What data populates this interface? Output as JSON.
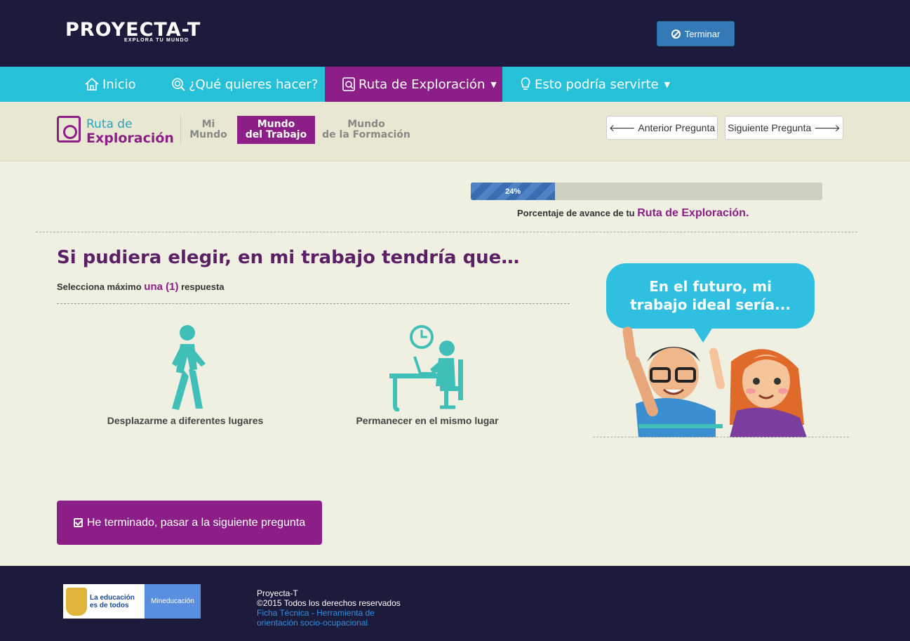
{
  "header": {
    "logo_text": "PROYECTA-T",
    "logo_subtitle": "EXPLORA TU MUNDO",
    "terminar_label": "Terminar"
  },
  "nav": {
    "items": [
      {
        "label": "Inicio",
        "icon": "home-icon"
      },
      {
        "label": "¿Qué quieres hacer?",
        "icon": "search-icon"
      },
      {
        "label": "Ruta de Exploración",
        "icon": "exploration-icon",
        "active": true
      },
      {
        "label": "Esto podría servirte",
        "icon": "bulb-icon"
      }
    ]
  },
  "subheader": {
    "brand_line1": "Ruta de",
    "brand_line2": "Exploración",
    "tabs": [
      {
        "line1": "Mi",
        "line2": "Mundo"
      },
      {
        "line1": "Mundo",
        "line2": "del Trabajo",
        "active": true
      },
      {
        "line1": "Mundo",
        "line2": "de la Formación"
      }
    ],
    "prev_label": "Anterior Pregunta",
    "next_label": "Siguiente Pregunta"
  },
  "progress": {
    "percent": 24,
    "percent_text": "24%",
    "label_prefix": "Porcentaje de avance de tu",
    "label_highlight": "Ruta de Exploración."
  },
  "question": {
    "title": "Si pudiera elegir, en mi trabajo tendría que…",
    "instruction_prefix": "Selecciona máximo",
    "instruction_highlight": "una (1)",
    "instruction_suffix": "respuesta",
    "options": [
      {
        "label": "Desplazarme a diferentes lugares",
        "icon": "walking-person-icon"
      },
      {
        "label": "Permanecer en el mismo lugar",
        "icon": "person-at-desk-icon"
      }
    ]
  },
  "illustration": {
    "bubble_line1": "En el futuro, mi",
    "bubble_line2": "trabajo ideal sería..."
  },
  "next_button_label": "He terminado, pasar a la siguiente pregunta",
  "footer": {
    "gov_line1": "La educación",
    "gov_line2": "es de todos",
    "gov_right": "Mineducación",
    "line1": "Proyecta-T",
    "line2": "©2015 Todos los derechos reservados",
    "link1": "Ficha Técnica - Herramienta de",
    "link2": "orientación socio-ocupacional"
  },
  "colors": {
    "header_bg": "#1d1b3c",
    "nav_bg": "#27c0d9",
    "accent_purple": "#8c1f87",
    "progress_blue": "#3a6db0",
    "teal_icons": "#3fbfb7"
  }
}
